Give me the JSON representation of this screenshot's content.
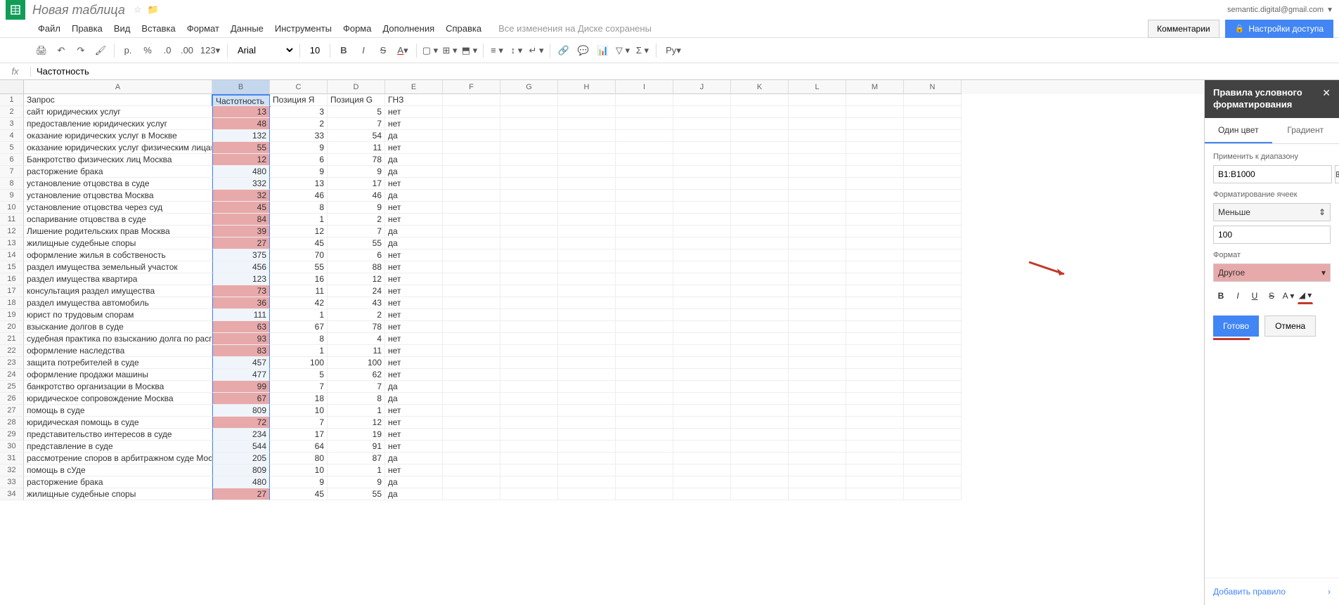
{
  "header": {
    "doc_title": "Новая таблица",
    "user_email": "semantic.digital@gmail.com"
  },
  "menu": {
    "items": [
      "Файл",
      "Правка",
      "Вид",
      "Вставка",
      "Формат",
      "Данные",
      "Инструменты",
      "Форма",
      "Дополнения",
      "Справка"
    ],
    "save_status": "Все изменения на Диске сохранены",
    "comments_btn": "Комментарии",
    "share_btn": "Настройки доступа"
  },
  "toolbar": {
    "currency": "р.",
    "percent": "%",
    "dec_dec": ".0",
    "dec_inc": ".00",
    "num_format": "123",
    "font_name": "Arial",
    "font_size": "10",
    "ru_label": "Ру"
  },
  "formula": {
    "fx": "fx",
    "value": "Частотность"
  },
  "columns": [
    "A",
    "B",
    "C",
    "D",
    "E",
    "F",
    "G",
    "H",
    "I",
    "J",
    "K",
    "L",
    "M",
    "N"
  ],
  "headers_row": {
    "A": "Запрос",
    "B": "Частотность",
    "C": "Позиция Я",
    "D": "Позиция G",
    "E": "ГНЗ"
  },
  "rows": [
    {
      "n": 2,
      "A": "сайт юридических услуг",
      "B": 13,
      "C": 3,
      "D": 5,
      "E": "нет"
    },
    {
      "n": 3,
      "A": "предоставление юридических услуг",
      "B": 48,
      "C": 2,
      "D": 7,
      "E": "нет"
    },
    {
      "n": 4,
      "A": "оказание юридических услуг в Москве",
      "B": 132,
      "C": 33,
      "D": 54,
      "E": "да"
    },
    {
      "n": 5,
      "A": "оказание юридических услуг физическим лицам",
      "B": 55,
      "C": 9,
      "D": 11,
      "E": "нет"
    },
    {
      "n": 6,
      "A": "Банкротство физических лиц Москва",
      "B": 12,
      "C": 6,
      "D": 78,
      "E": "да"
    },
    {
      "n": 7,
      "A": "расторжение брака",
      "B": 480,
      "C": 9,
      "D": 9,
      "E": "да"
    },
    {
      "n": 8,
      "A": "установление отцовства в суде",
      "B": 332,
      "C": 13,
      "D": 17,
      "E": "нет"
    },
    {
      "n": 9,
      "A": "установление отцовства Москва",
      "B": 32,
      "C": 46,
      "D": 46,
      "E": "да"
    },
    {
      "n": 10,
      "A": "установление отцовства через суд",
      "B": 45,
      "C": 8,
      "D": 9,
      "E": "нет"
    },
    {
      "n": 11,
      "A": "оспаривание отцовства в суде",
      "B": 84,
      "C": 1,
      "D": 2,
      "E": "нет"
    },
    {
      "n": 12,
      "A": "Лишение родительских прав Москва",
      "B": 39,
      "C": 12,
      "D": 7,
      "E": "да"
    },
    {
      "n": 13,
      "A": "жилищные судебные споры",
      "B": 27,
      "C": 45,
      "D": 55,
      "E": "да"
    },
    {
      "n": 14,
      "A": "оформление жилья в собственость",
      "B": 375,
      "C": 70,
      "D": 6,
      "E": "нет"
    },
    {
      "n": 15,
      "A": "раздел имущества земельный участок",
      "B": 456,
      "C": 55,
      "D": 88,
      "E": "нет"
    },
    {
      "n": 16,
      "A": "раздел имущества квартира",
      "B": 123,
      "C": 16,
      "D": 12,
      "E": "нет"
    },
    {
      "n": 17,
      "A": "консультация раздел имущества",
      "B": 73,
      "C": 11,
      "D": 24,
      "E": "нет"
    },
    {
      "n": 18,
      "A": "раздел имущества автомобиль",
      "B": 36,
      "C": 42,
      "D": 43,
      "E": "нет"
    },
    {
      "n": 19,
      "A": "юрист по трудовым спорам",
      "B": 111,
      "C": 1,
      "D": 2,
      "E": "нет"
    },
    {
      "n": 20,
      "A": "взыскание долгов в суде",
      "B": 63,
      "C": 67,
      "D": 78,
      "E": "нет"
    },
    {
      "n": 21,
      "A": "судебная практика по взысканию долга по расписке",
      "B": 93,
      "C": 8,
      "D": 4,
      "E": "нет"
    },
    {
      "n": 22,
      "A": "оформление наследства",
      "B": 83,
      "C": 1,
      "D": 11,
      "E": "нет"
    },
    {
      "n": 23,
      "A": "защита потребителей в суде",
      "B": 457,
      "C": 100,
      "D": 100,
      "E": "нет"
    },
    {
      "n": 24,
      "A": "оформление продажи машины",
      "B": 477,
      "C": 5,
      "D": 62,
      "E": "нет"
    },
    {
      "n": 25,
      "A": "банкротство организации в Москва",
      "B": 99,
      "C": 7,
      "D": 7,
      "E": "да"
    },
    {
      "n": 26,
      "A": "юридическое сопровождение Москва",
      "B": 67,
      "C": 18,
      "D": 8,
      "E": "да"
    },
    {
      "n": 27,
      "A": "помощь в суде",
      "B": 809,
      "C": 10,
      "D": 1,
      "E": "нет"
    },
    {
      "n": 28,
      "A": "юридическая помощь в суде",
      "B": 72,
      "C": 7,
      "D": 12,
      "E": "нет"
    },
    {
      "n": 29,
      "A": "представительство интересов в суде",
      "B": 234,
      "C": 17,
      "D": 19,
      "E": "нет"
    },
    {
      "n": 30,
      "A": "представление в суде",
      "B": 544,
      "C": 64,
      "D": 91,
      "E": "нет"
    },
    {
      "n": 31,
      "A": "рассмотрение споров в арбитражном суде Москва",
      "B": 205,
      "C": 80,
      "D": 87,
      "E": "да"
    },
    {
      "n": 32,
      "A": "помощь в сУде",
      "B": 809,
      "C": 10,
      "D": 1,
      "E": "нет"
    },
    {
      "n": 33,
      "A": "расторжение брака",
      "B": 480,
      "C": 9,
      "D": 9,
      "E": "да"
    },
    {
      "n": 34,
      "A": "жилищные судебные споры",
      "B": 27,
      "C": 45,
      "D": 55,
      "E": "да"
    }
  ],
  "cf_threshold": 100,
  "panel": {
    "title": "Правила условного форматирования",
    "tab_single": "Один цвет",
    "tab_gradient": "Градиент",
    "apply_range_label": "Применить к диапазону",
    "range_value": "B1:B1000",
    "format_cells_label": "Форматирование ячеек",
    "condition": "Меньше",
    "value": "100",
    "format_label": "Формат",
    "format_preview": "Другое",
    "done": "Готово",
    "cancel": "Отмена",
    "add_rule": "Добавить правило"
  }
}
